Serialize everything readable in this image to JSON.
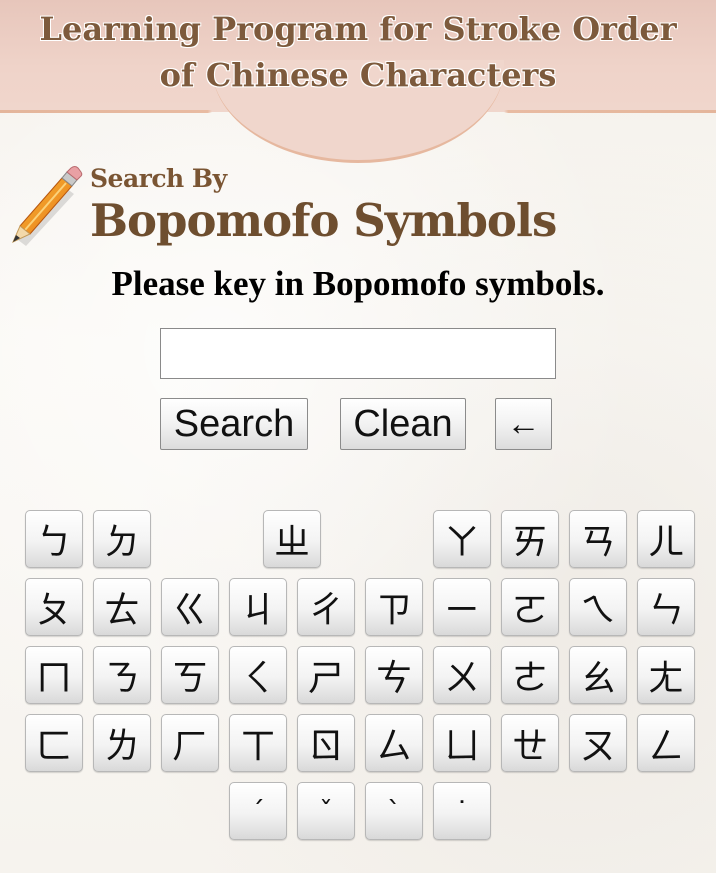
{
  "header": {
    "title_line1": "Learning Program for Stroke Order",
    "title_line2": "of Chinese Characters"
  },
  "section": {
    "search_by": "Search By",
    "title": "Bopomofo Symbols",
    "icon": "pencil-icon"
  },
  "instruction": "Please key in Bopomofo symbols.",
  "input": {
    "value": "",
    "placeholder": ""
  },
  "buttons": {
    "search": "Search",
    "clean": "Clean",
    "backspace": "←"
  },
  "keyboard": {
    "row1": [
      "ㄅ",
      "ㄉ",
      "",
      "ㄓ",
      "",
      "ㄚ",
      "ㄞ",
      "ㄢ",
      "ㄦ"
    ],
    "row2": [
      "ㄆ",
      "ㄊ",
      "ㄍ",
      "ㄐ",
      "ㄔ",
      "ㄗ",
      "ㄧ",
      "ㄛ",
      "ㄟ",
      "ㄣ"
    ],
    "row3": [
      "ㄇ",
      "ㄋ",
      "ㄎ",
      "ㄑ",
      "ㄕ",
      "ㄘ",
      "ㄨ",
      "ㄜ",
      "ㄠ",
      "ㄤ"
    ],
    "row4": [
      "ㄈ",
      "ㄌ",
      "ㄏ",
      "ㄒ",
      "ㄖ",
      "ㄙ",
      "ㄩ",
      "ㄝ",
      "ㄡ",
      "ㄥ"
    ],
    "tones": [
      "ˊ",
      "ˇ",
      "ˋ",
      "˙"
    ]
  }
}
